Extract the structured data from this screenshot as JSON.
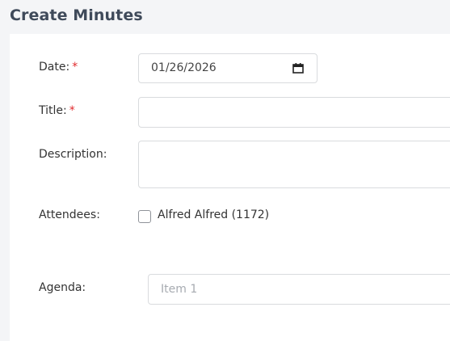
{
  "page": {
    "title": "Create Minutes"
  },
  "form": {
    "date": {
      "label": "Date:",
      "required_mark": "*",
      "value": "01/26/2026"
    },
    "title": {
      "label": "Title:",
      "required_mark": "*",
      "value": ""
    },
    "description": {
      "label": "Description:",
      "value": ""
    },
    "attendees": {
      "label": "Attendees:",
      "options": [
        {
          "label": "Alfred Alfred (1172)",
          "checked": false
        }
      ]
    },
    "agenda": {
      "label": "Agenda:",
      "placeholder": "Item 1"
    }
  },
  "colors": {
    "background": "#f4f5f7",
    "card": "#ffffff",
    "required": "#e0292c",
    "border": "#d9dbde"
  },
  "icons": {
    "date_picker": "calendar-icon"
  }
}
